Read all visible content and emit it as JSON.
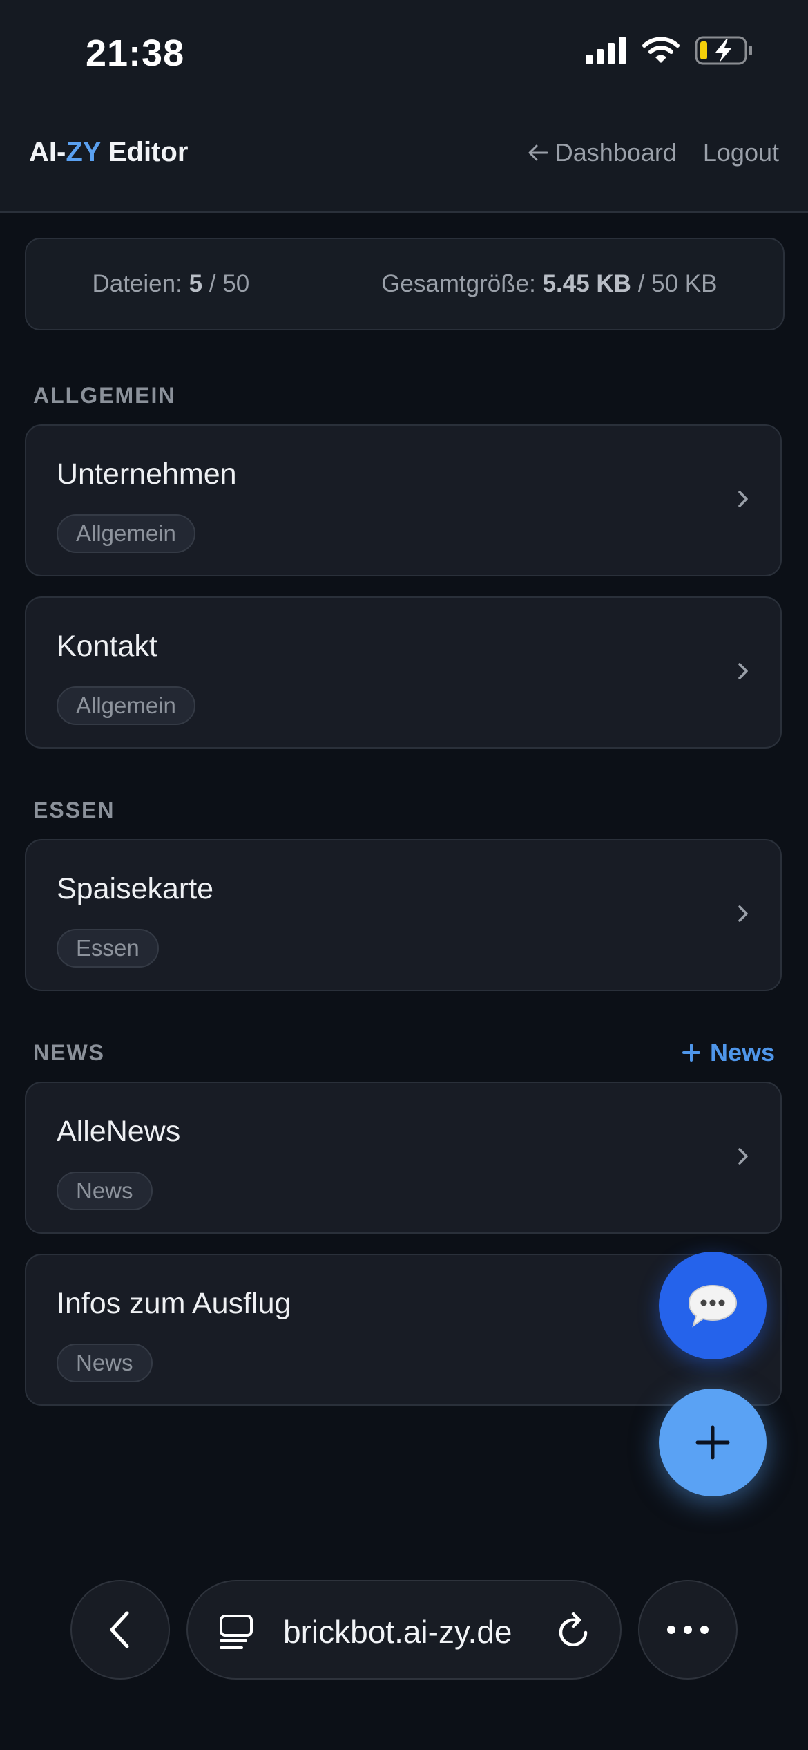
{
  "status_bar": {
    "time": "21:38"
  },
  "header": {
    "brand_prefix": "AI-",
    "brand_accent": "ZY",
    "brand_suffix": " Editor",
    "dashboard_label": "Dashboard",
    "logout_label": "Logout"
  },
  "stats": {
    "files_label": "Dateien:",
    "files_count": "5",
    "files_limit": "/ 50",
    "size_label": "Gesamtgröße:",
    "size_value": "5.45 KB",
    "size_limit": "/ 50 KB"
  },
  "sections": {
    "allgemein": {
      "label": "ALLGEMEIN",
      "items": [
        {
          "title": "Unternehmen",
          "tag": "Allgemein"
        },
        {
          "title": "Kontakt",
          "tag": "Allgemein"
        }
      ]
    },
    "essen": {
      "label": "ESSEN",
      "items": [
        {
          "title": "Spaisekarte",
          "tag": "Essen"
        }
      ]
    },
    "news": {
      "label": "NEWS",
      "add_label": "News",
      "items": [
        {
          "title": "AlleNews",
          "tag": "News"
        },
        {
          "title": "Infos zum Ausflug",
          "tag": "News"
        }
      ]
    }
  },
  "browser": {
    "url": "brickbot.ai-zy.de"
  },
  "colors": {
    "accent": "#5aa0f0",
    "chat_fab": "#2563eb",
    "add_fab": "#5aa2f4",
    "background": "#0c1017",
    "card": "#181c25"
  }
}
